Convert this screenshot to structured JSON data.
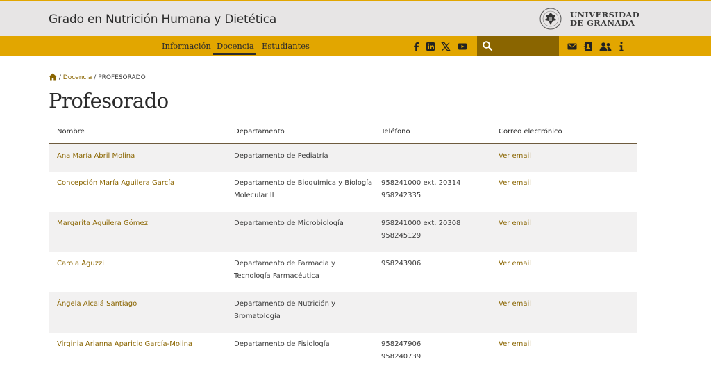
{
  "header": {
    "title": "Grado en Nutrición Humana y Dietética",
    "university_line1": "UNIVERSIDAD",
    "university_line2": "DE GRANADA"
  },
  "nav": {
    "items": [
      "Información",
      "Docencia",
      "Estudiantes"
    ],
    "active": "Docencia"
  },
  "social": [
    "facebook-icon",
    "linkedin-icon",
    "x-icon",
    "youtube-icon"
  ],
  "search": {
    "placeholder": ""
  },
  "right_icons": [
    "mail-icon",
    "directory-icon",
    "people-icon",
    "info-icon"
  ],
  "breadcrumb": {
    "separator": "/",
    "link": "Docencia",
    "current": "PROFESORADO"
  },
  "page_title": "Profesorado",
  "table": {
    "headers": [
      "Nombre",
      "Departamento",
      "Teléfono",
      "Correo electrónico"
    ],
    "rows": [
      {
        "name": "Ana María Abril Molina",
        "dept": "Departamento de Pediatría",
        "phones": [
          "",
          ""
        ],
        "email": "Ver email"
      },
      {
        "name": "Concepción María Aguilera García",
        "dept": "Departamento de Bioquímica y Biología Molecular II",
        "phones": [
          "958241000 ext. 20314",
          "958242335"
        ],
        "email": "Ver email"
      },
      {
        "name": "Margarita Aguilera Gómez",
        "dept": "Departamento de Microbiología",
        "phones": [
          "958241000 ext. 20308",
          "958245129"
        ],
        "email": "Ver email"
      },
      {
        "name": "Carola Aguzzi",
        "dept": "Departamento de Farmacia y Tecnología Farmacéutica",
        "phones": [
          "958243906",
          ""
        ],
        "email": "Ver email"
      },
      {
        "name": "Ángela Alcalá Santiago",
        "dept": "Departamento de Nutrición y Bromatología",
        "phones": [
          "",
          ""
        ],
        "email": "Ver email"
      },
      {
        "name": "Virginia Arianna Aparicio García-Molina",
        "dept": "Departamento de Fisiología",
        "phones": [
          "958247906",
          "958240739"
        ],
        "email": "Ver email"
      }
    ]
  },
  "colors": {
    "accent": "#e2a600",
    "link": "#8a6500",
    "header_bg": "#e7e5e5",
    "search_bg": "#8a6500"
  }
}
